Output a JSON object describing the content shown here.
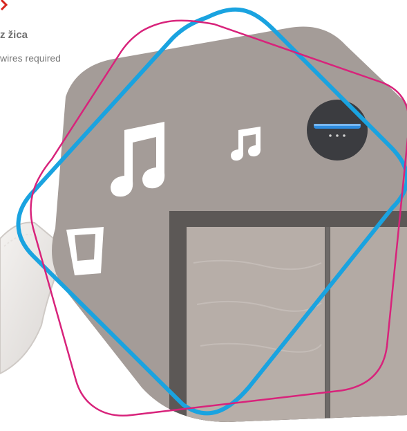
{
  "caption": {
    "title": "z žica",
    "subtitle": "wires required"
  },
  "colors": {
    "accent_red": "#d7261e",
    "ring_blue": "#1aa3e0",
    "ring_magenta": "#d8237b",
    "wall_gray": "#a49c98",
    "door_frame": "#5c5856",
    "door_panel": "#b7aea8",
    "speaker_dark": "#3b3c40",
    "speaker_light": "#2f8de0"
  },
  "icons": [
    "music-note-large",
    "music-note-small",
    "doorbell-speaker",
    "drinking-glass",
    "white-pillow"
  ]
}
